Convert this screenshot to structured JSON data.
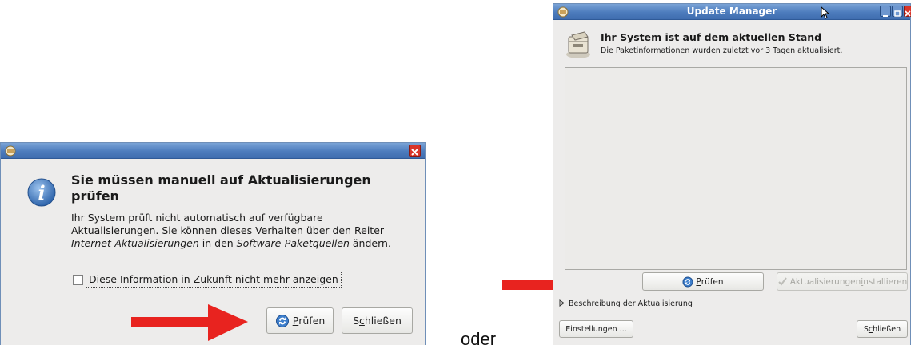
{
  "dialog": {
    "heading_line1": "Sie müssen manuell auf Aktualisierungen",
    "heading_line2": "prüfen",
    "body_line1": "Ihr System prüft nicht automatisch auf verfügbare",
    "body_line2": "Aktualisierungen. Sie können dieses Verhalten über den Reiter",
    "body_line3_em1": "Internet-Aktualisierungen",
    "body_line3_mid": " in den ",
    "body_line3_em2": "Software-Paketquellen",
    "body_line3_end": " ändern.",
    "checkbox_pre": "Diese Information in Zukunft ",
    "checkbox_u": "n",
    "checkbox_post": "icht mehr anzeigen",
    "check_btn_u": "P",
    "check_btn_rest": "rüfen",
    "close_btn_pre": "S",
    "close_btn_u": "c",
    "close_btn_rest": "hließen"
  },
  "connector": "oder",
  "update_manager": {
    "title": "Update Manager",
    "status_title": "Ihr System ist auf dem aktuellen Stand",
    "status_sub": "Die Paketinformationen wurden zuletzt vor 3 Tagen aktualisiert.",
    "check_btn_u": "P",
    "check_btn_rest": "rüfen",
    "install_btn_pre": "Aktualisierungen ",
    "install_btn_u": "i",
    "install_btn_rest": "nstallieren",
    "description_label": "Beschreibung der Aktualisierung",
    "settings_btn": "Einstellungen ...",
    "close_btn_pre": "S",
    "close_btn_u": "c",
    "close_btn_rest": "hließen"
  },
  "colors": {
    "arrow": "#e8231f",
    "titlebar": "#4d7cbd",
    "close_red": "#d9352a"
  }
}
